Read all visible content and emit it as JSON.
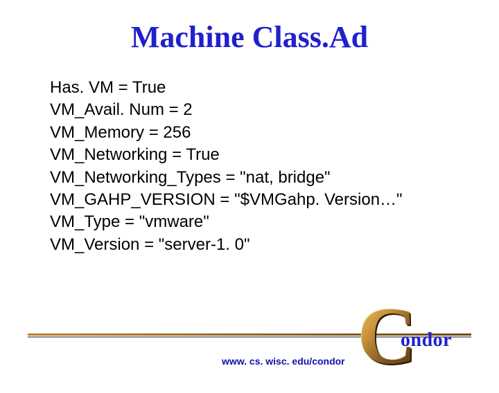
{
  "title": "Machine Class.Ad",
  "lines": [
    "Has. VM = True",
    "VM_Avail. Num = 2",
    "VM_Memory = 256",
    "VM_Networking = True",
    "VM_Networking_Types = \"nat, bridge\"",
    "VM_GAHP_VERSION = \"$VMGahp. Version…\"",
    "VM_Type = \"vmware\"",
    "VM_Version = \"server-1. 0\""
  ],
  "footer_url": "www. cs. wisc. edu/condor",
  "logo": {
    "c": "C",
    "rest": "ondor"
  }
}
